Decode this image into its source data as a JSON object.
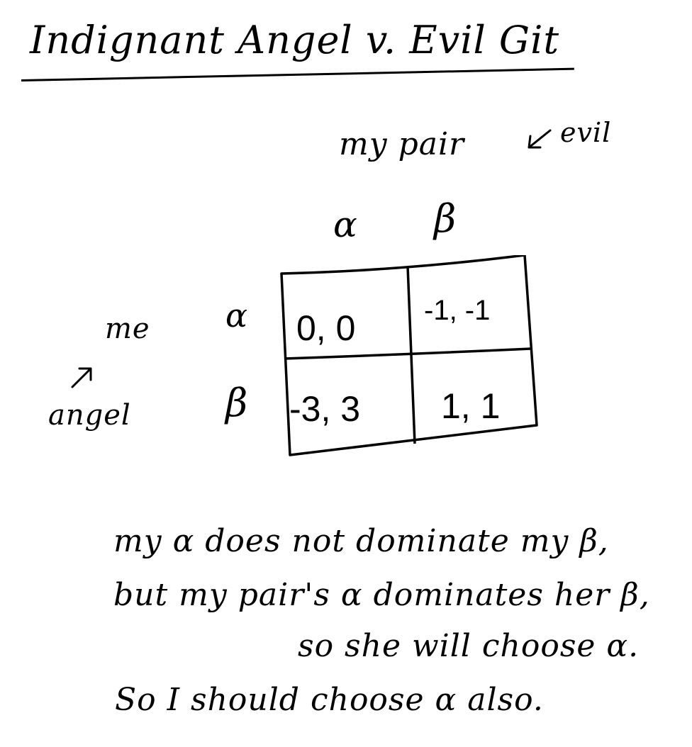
{
  "title": "Indignant Angel  v.  Evil Git",
  "column_player": {
    "label": "my pair",
    "note": "evil"
  },
  "row_player": {
    "label": "me",
    "note": "angel"
  },
  "strategies": {
    "columns": [
      "α",
      "β"
    ],
    "rows": [
      "α",
      "β"
    ]
  },
  "payoffs": [
    [
      "0, 0",
      "-1, -1"
    ],
    [
      "-3, 3",
      "1, 1"
    ]
  ],
  "reasoning": [
    "my α does not dominate my β,",
    "but my pair's α dominates her β,",
    "so she will choose α.",
    "So I should choose α also."
  ]
}
